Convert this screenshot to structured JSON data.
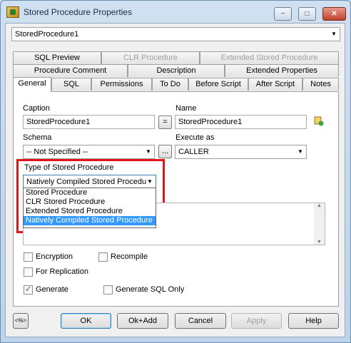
{
  "window": {
    "title": "Stored Procedure Properties",
    "minimize": "−",
    "maximize": "□",
    "close": "✕"
  },
  "top_combo": {
    "value": "StoredProcedure1"
  },
  "tabs": {
    "row1": [
      "SQL Preview",
      "CLR Procedure",
      "Extended Stored Procedure"
    ],
    "row2": [
      "Procedure Comment",
      "Description",
      "Extended Properties"
    ],
    "row3": [
      "General",
      "SQL",
      "Permissions",
      "To Do",
      "Before Script",
      "After Script",
      "Notes"
    ]
  },
  "general": {
    "caption_label": "Caption",
    "caption_value": "StoredProcedure1",
    "equals_label": "=",
    "name_label": "Name",
    "name_value": "StoredProcedure1",
    "schema_label": "Schema",
    "schema_value": "-- Not Specified --",
    "ellipsis_label": "...",
    "execute_as_label": "Execute as",
    "execute_as_value": "CALLER",
    "type_label": "Type of Stored Procedure",
    "type_value": "Natively Compiled Stored Procedu",
    "type_options": [
      "Stored Procedure",
      "CLR Stored Procedure",
      "Extended Stored Procedure",
      "Natively Compiled Stored Procedure"
    ],
    "encryption_label": "Encryption",
    "recompile_label": "Recompile",
    "for_replication_label": "For Replication",
    "generate_label": "Generate",
    "generate_sql_only_label": "Generate SQL Only"
  },
  "buttons": {
    "nav": "<%>",
    "ok": "OK",
    "ok_add": "Ok+Add",
    "cancel": "Cancel",
    "apply": "Apply",
    "help": "Help"
  }
}
